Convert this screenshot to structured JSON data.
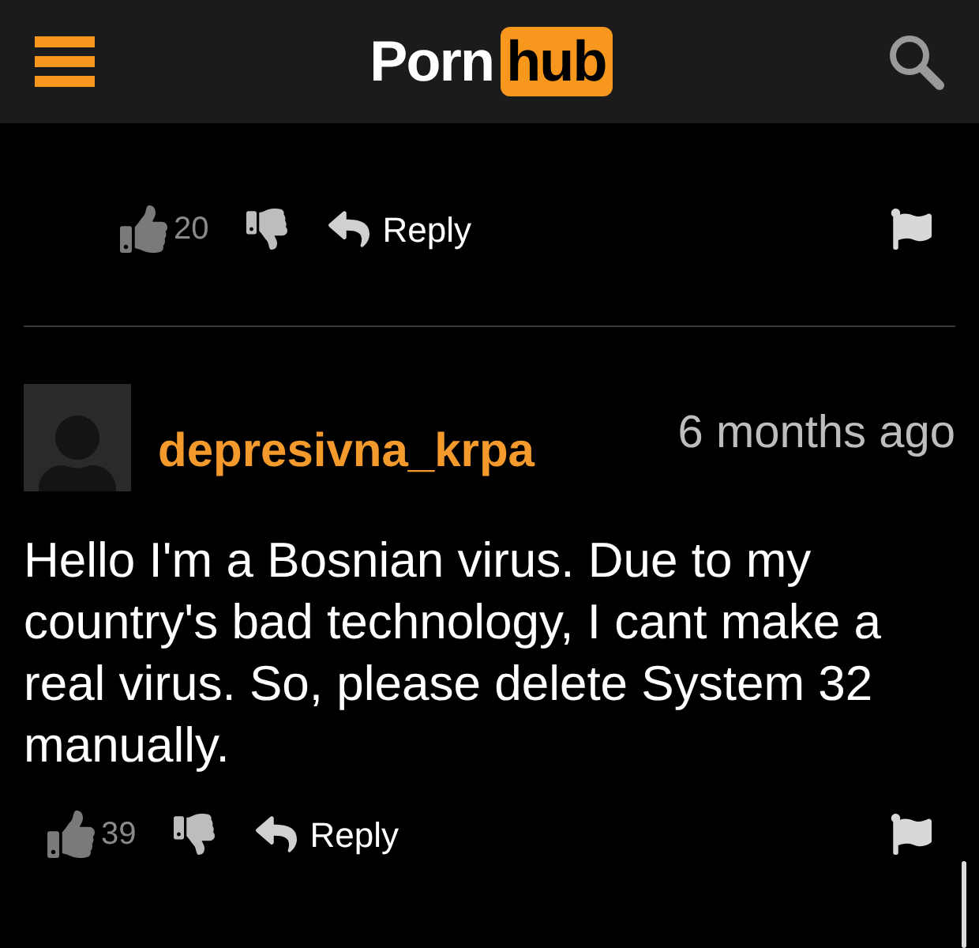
{
  "header": {
    "logo_left": "Porn",
    "logo_right": "hub"
  },
  "top_actions": {
    "likes": "20",
    "reply_label": "Reply"
  },
  "comment": {
    "username": "depresivna_krpa",
    "time": "6 months ago",
    "text": "Hello I'm a Bosnian virus. Due to my country's bad technology, I cant make a real virus. So, please delete System 32 manually.",
    "likes": "39",
    "reply_label": "Reply"
  }
}
